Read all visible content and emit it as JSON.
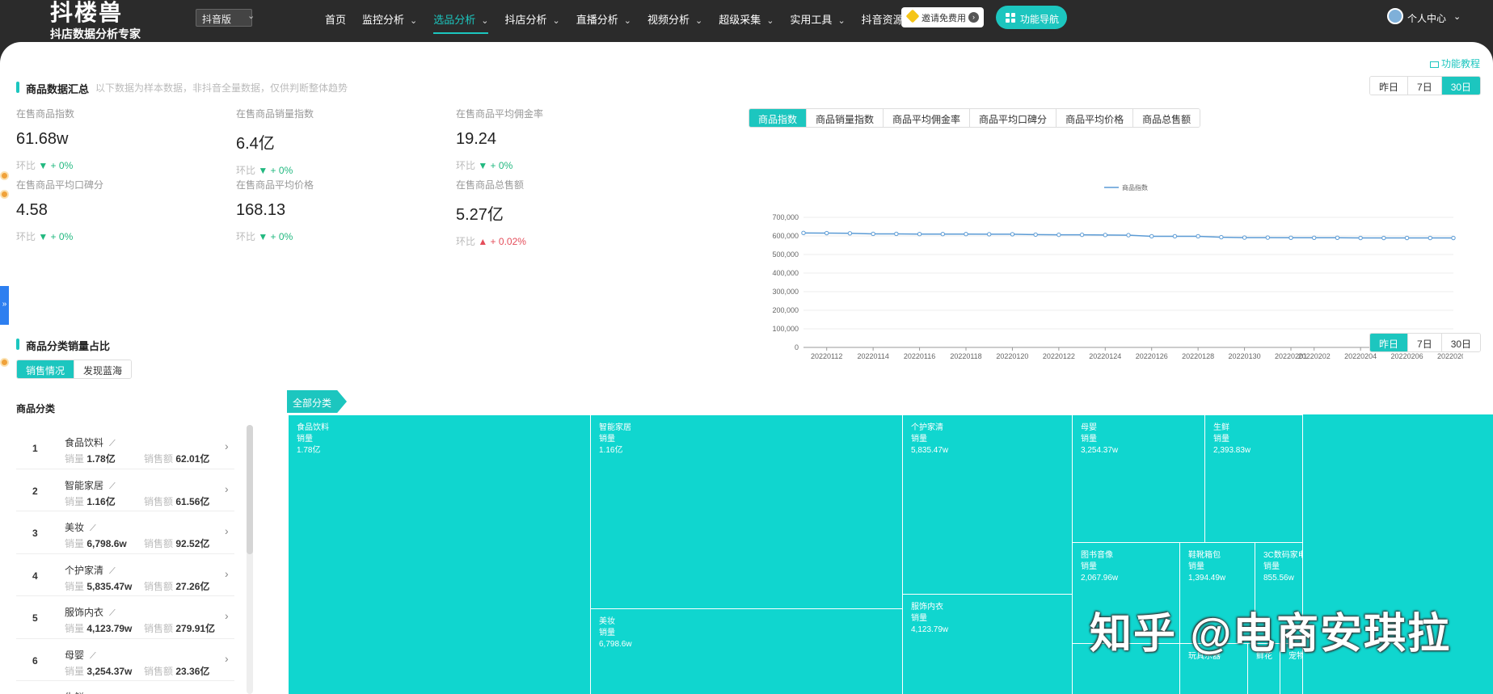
{
  "topbar": {
    "logo_title": "抖楼兽",
    "logo_subtitle": "抖店数据分析专家",
    "version_select": "抖音版",
    "nav": [
      {
        "label": "首页",
        "dropdown": false,
        "active": false
      },
      {
        "label": "监控分析",
        "dropdown": true,
        "active": false
      },
      {
        "label": "选品分析",
        "dropdown": true,
        "active": true
      },
      {
        "label": "抖店分析",
        "dropdown": true,
        "active": false
      },
      {
        "label": "直播分析",
        "dropdown": true,
        "active": false
      },
      {
        "label": "视频分析",
        "dropdown": true,
        "active": false
      },
      {
        "label": "超级采集",
        "dropdown": true,
        "active": false
      },
      {
        "label": "实用工具",
        "dropdown": true,
        "active": false
      },
      {
        "label": "抖音资源",
        "dropdown": true,
        "active": false
      }
    ],
    "invite_label": "邀请免费用",
    "func_nav_label": "功能导航",
    "user_label": "个人中心"
  },
  "tutorial_link": "功能教程",
  "summary": {
    "title": "商品数据汇总",
    "note": "以下数据为样本数据，非抖音全量数据，仅供判断整体趋势",
    "range_tabs": [
      "昨日",
      "7日",
      "30日"
    ],
    "active_range": "30日",
    "metrics": [
      {
        "label": "在售商品指数",
        "value": "61.68w",
        "change_prefix": "环比",
        "change": "▼ + 0%",
        "trend": "down"
      },
      {
        "label": "在售商品销量指数",
        "value": "6.4亿",
        "change_prefix": "环比",
        "change": "▼ + 0%",
        "trend": "down"
      },
      {
        "label": "在售商品平均佣金率",
        "value": "19.24",
        "change_prefix": "环比",
        "change": "▼ + 0%",
        "trend": "down"
      },
      {
        "label": "在售商品平均口碑分",
        "value": "4.58",
        "change_prefix": "环比",
        "change": "▼ + 0%",
        "trend": "down"
      },
      {
        "label": "在售商品平均价格",
        "value": "168.13",
        "change_prefix": "环比",
        "change": "▼ + 0%",
        "trend": "down"
      },
      {
        "label": "在售商品总售额",
        "value": "5.27亿",
        "change_prefix": "环比",
        "change": "▲ + 0.02%",
        "trend": "up"
      }
    ]
  },
  "chart_tabs": [
    "商品指数",
    "商品销量指数",
    "商品平均佣金率",
    "商品平均口碑分",
    "商品平均价格",
    "商品总售额"
  ],
  "active_chart_tab": "商品指数",
  "chart_data": {
    "type": "line",
    "series": [
      {
        "name": "商品指数",
        "color": "#5b9bd5",
        "values": [
          616000,
          615000,
          614000,
          611000,
          611000,
          610000,
          610000,
          610000,
          609000,
          609000,
          607000,
          606000,
          606000,
          605000,
          604000,
          598000,
          598000,
          598000,
          593000,
          591000,
          591000,
          590000,
          590000,
          590000,
          589000,
          589000,
          589000,
          589000,
          589000
        ]
      }
    ],
    "x": [
      "20220111",
      "20220112",
      "20220113",
      "20220114",
      "20220115",
      "20220116",
      "20220117",
      "20220118",
      "20220119",
      "20220120",
      "20220121",
      "20220122",
      "20220123",
      "20220124",
      "20220125",
      "20220126",
      "20220127",
      "20220128",
      "20220129",
      "20220130",
      "20220131",
      "20220201",
      "20220202",
      "20220203",
      "20220204",
      "20220205",
      "20220206",
      "20220207",
      "20220208"
    ],
    "x_tick_labels": [
      "20220112",
      "20220114",
      "20220116",
      "20220118",
      "20220120",
      "20220122",
      "20220124",
      "20220126",
      "20220128",
      "20220130",
      "20220201",
      "20220202",
      "20220204",
      "20220206",
      "20220208"
    ],
    "y_ticks": [
      "0",
      "100,000",
      "200,000",
      "300,000",
      "400,000",
      "500,000",
      "600,000",
      "700,000"
    ],
    "ylim": [
      0,
      700000
    ],
    "grid": true,
    "legend": "top-center"
  },
  "category": {
    "title": "商品分类销量占比",
    "range_tabs": [
      "昨日",
      "7日",
      "30日"
    ],
    "active_range": "昨日",
    "sub_tabs": [
      "销售情况",
      "发现蓝海"
    ],
    "active_sub_tab": "销售情况",
    "list_header": "商品分类",
    "vol_label": "销量",
    "amt_label": "销售额",
    "items": [
      {
        "rank": "1",
        "name": "食品饮料",
        "volume": "1.78亿",
        "amount": "62.01亿"
      },
      {
        "rank": "2",
        "name": "智能家居",
        "volume": "1.16亿",
        "amount": "61.56亿"
      },
      {
        "rank": "3",
        "name": "美妆",
        "volume": "6,798.6w",
        "amount": "92.52亿"
      },
      {
        "rank": "4",
        "name": "个护家清",
        "volume": "5,835.47w",
        "amount": "27.26亿"
      },
      {
        "rank": "5",
        "name": "服饰内衣",
        "volume": "4,123.79w",
        "amount": "279.91亿"
      },
      {
        "rank": "6",
        "name": "母婴",
        "volume": "3,254.37w",
        "amount": "23.36亿"
      },
      {
        "rank": "7",
        "name": "生鲜",
        "volume": "",
        "amount": ""
      }
    ]
  },
  "treemap": {
    "breadcrumb": "全部分类",
    "metric_label": "销量",
    "color": "#10d6cf",
    "cells": [
      {
        "name": "食品饮料",
        "value": "1.78亿"
      },
      {
        "name": "智能家居",
        "value": "1.16亿"
      },
      {
        "name": "美妆",
        "value": "6,798.6w"
      },
      {
        "name": "个护家清",
        "value": "5,835.47w"
      },
      {
        "name": "服饰内衣",
        "value": "4,123.79w"
      },
      {
        "name": "母婴",
        "value": "3,254.37w"
      },
      {
        "name": "生鲜",
        "value": "2,393.83w"
      },
      {
        "name": "图书音像",
        "value": "2,067.96w"
      },
      {
        "name": "鞋靴箱包",
        "value": "1,394.49w"
      },
      {
        "name": "3C数码家电",
        "value": "855.56w"
      },
      {
        "name": "玩具乐器",
        "value": ""
      },
      {
        "name": "鲜花",
        "value": ""
      },
      {
        "name": "宠物",
        "value": ""
      }
    ]
  },
  "watermark": "知乎 @电商安琪拉"
}
